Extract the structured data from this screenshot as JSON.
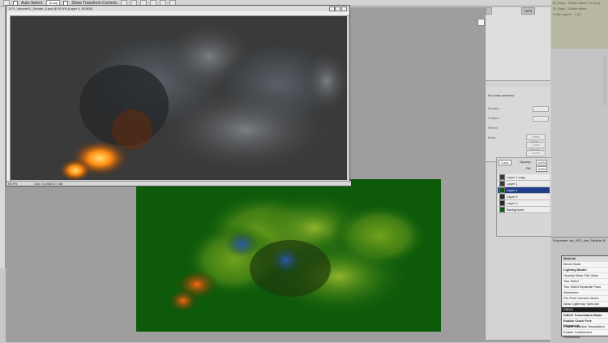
{
  "options_bar": {
    "auto_select_label": "Auto-Select:",
    "auto_select_value": "Group",
    "show_transform_label": "Show Transform Controls"
  },
  "doc1": {
    "title": "LFX_Volume01_Smoke_4.psd @ 50.9% (Layer 4, RGB/8)",
    "zoom": "50.9%",
    "doc_info": "Doc: 19.8M/107.4M"
  },
  "tool_panel": {
    "tab1": "",
    "tab2": "HIPS",
    "noatt_title": "No mask selected",
    "fields": [
      "Density:",
      "Feather:",
      "Refine:",
      "Mask:"
    ],
    "buttons": [
      "Mask Edge...",
      "Color Range...",
      "Invert"
    ]
  },
  "layers": {
    "blend": "Color",
    "opacity_label": "Opacity:",
    "opacity_value": "100%",
    "fill_label": "Fill:",
    "fill_value": "100%",
    "items": [
      {
        "name": "Layer 1 copy",
        "selected": false,
        "thumb": "#3a3a3a"
      },
      {
        "name": "Layer 1",
        "selected": false,
        "thumb": "#3a3a3a"
      },
      {
        "name": "Layer 4",
        "selected": true,
        "thumb": "#0d5a0a"
      },
      {
        "name": "Layer 3",
        "selected": false,
        "thumb": "#2a2a2a"
      },
      {
        "name": "Layer 2",
        "selected": false,
        "thumb": "#2a2a2a"
      },
      {
        "name": "Background",
        "selected": false,
        "thumb": "#0d5a0a"
      }
    ]
  },
  "info_panel": {
    "lines": [
      "Bl_Repo - Soliter alfred 3 d (Ctrl)",
      "Bl_Repo - Soliter alfred",
      "Soliter gaslin - 1 [?]"
    ]
  },
  "properties": {
    "title": "Properties: sfx_VFX_Inst_Particle 3F",
    "menu": [
      {
        "label": "Material",
        "type": "hd"
      },
      {
        "label": "Blend Mode",
        "type": ""
      },
      {
        "label": "Lighting Model",
        "type": "bold"
      },
      {
        "label": "Opacity Mask Clip Value",
        "type": ""
      },
      {
        "label": "Two Sided",
        "type": ""
      },
      {
        "label": "Two Sided Separate Pass",
        "type": ""
      },
      {
        "label": "Wireframe",
        "type": ""
      },
      {
        "label": "Per Pixel Camera Vector",
        "type": ""
      },
      {
        "label": "Allow Lightmap Specular",
        "type": ""
      },
      {
        "label": "D3D11",
        "type": "hl"
      },
      {
        "label": "D3D11 Tessellation Mode",
        "type": "bold"
      },
      {
        "label": "Enable Crack Free Displacem",
        "type": "bold"
      },
      {
        "label": "Enable Adaptive Tessellation",
        "type": ""
      },
      {
        "label": "Enable Customized Tessellation",
        "type": ""
      }
    ]
  },
  "colors": {
    "canvas_bg": "#9e9e9e",
    "smoke_bg": "#3a3a3a",
    "green_doc": "#0d5a0a",
    "selection": "#1f3f8a"
  }
}
